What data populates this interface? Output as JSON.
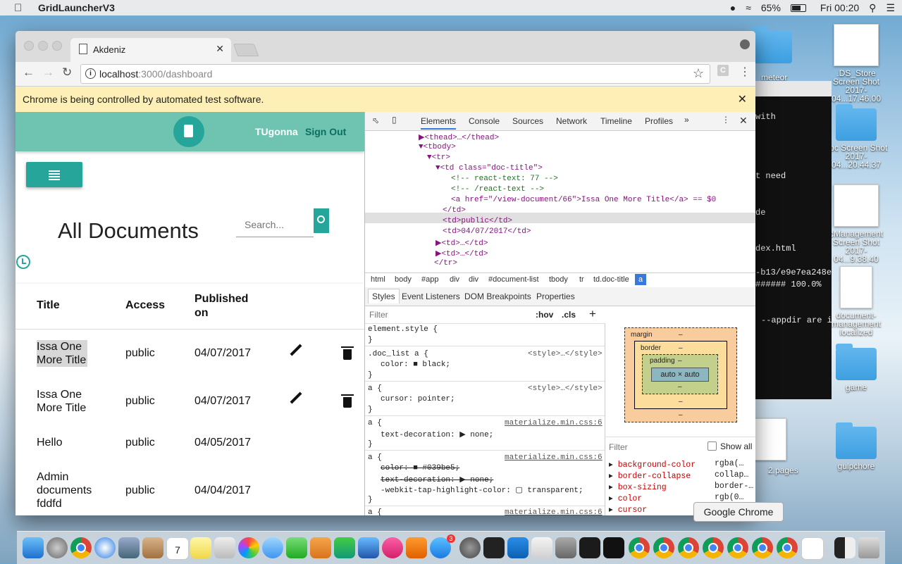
{
  "menubar": {
    "app_name": "GridLauncherV3",
    "battery": "65%",
    "clock": "Fri 00:20"
  },
  "desktop": {
    "icons": [
      {
        "label": "meteor"
      },
      {
        "label": ".DS_Store Screen Shot 2017-04...17.46.00"
      },
      {
        "label": "doc Screen Shot 2017-04...20.44.37"
      },
      {
        "label": "cManagement Screen Shot 2017-04...9.38.40"
      },
      {
        "label": "document-management"
      },
      {
        "label": "localized"
      },
      {
        "label": "game"
      },
      {
        "label": "2.pages"
      },
      {
        "label": "gulpchore"
      }
    ]
  },
  "terminal": {
    "lines": [
      "with",
      "t need",
      "de",
      "dex.html",
      "-b13/e9e7ea248e",
      "###### 100.0%",
      "--appdir are i"
    ]
  },
  "browser": {
    "tab_title": "Akdeniz",
    "url_host": "localhost",
    "url_path": ":3000/dashboard",
    "ext_label": "C",
    "infobar": "Chrome is being controlled by automated test software."
  },
  "app": {
    "user": "TUgonna",
    "signout": "Sign Out",
    "heading": "All Documents",
    "search_placeholder": "Search...",
    "columns": [
      "Title",
      "Access",
      "Published on"
    ],
    "rows": [
      {
        "title": "Issa One More Title",
        "access": "public",
        "date": "04/07/2017",
        "actions": true
      },
      {
        "title": "Issa One More Title",
        "access": "public",
        "date": "04/07/2017",
        "actions": true
      },
      {
        "title": "Hello",
        "access": "public",
        "date": "04/05/2017",
        "actions": false
      },
      {
        "title": "Admin documents fddfd",
        "access": "public",
        "date": "04/04/2017",
        "actions": false
      }
    ]
  },
  "devtools": {
    "tabs": [
      "Elements",
      "Console",
      "Sources",
      "Network",
      "Timeline",
      "Profiles"
    ],
    "dom": [
      "▶<thead>…</thead>",
      "▼<tbody>",
      "▼<tr>",
      "▼<td class=\"doc-title\">",
      "<!-- react-text: 77 -->",
      "<!-- /react-text -->",
      "<a href=\"/view-document/66\">Issa One More Title</a> == $0",
      "</td>",
      "<td>public</td>",
      "<td>04/07/2017</td>",
      "▶<td>…</td>",
      "▶<td>…</td>",
      "</tr>"
    ],
    "breadcrumbs": [
      "html",
      "body",
      "#app",
      "div",
      "div",
      "#document-list",
      "tbody",
      "tr",
      "td.doc-title",
      "a"
    ],
    "subtabs": [
      "Styles",
      "Event Listeners",
      "DOM Breakpoints",
      "Properties"
    ],
    "filter_placeholder": "Filter",
    "hov": ":hov",
    "cls": ".cls",
    "styles": [
      {
        "sel": "element.style {",
        "src": ""
      },
      {
        "sel": ".doc_list a {",
        "src": "<style>…</style>",
        "props": [
          "color: ■ black;"
        ]
      },
      {
        "sel": "a {",
        "src": "<style>…</style>",
        "props": [
          "cursor: pointer;"
        ]
      },
      {
        "sel": "a {",
        "src": "materialize.min.css:6",
        "props": [
          "text-decoration: ▶ none;"
        ]
      },
      {
        "sel": "a {",
        "src": "materialize.min.css:6",
        "props": [
          "color: ■ #039be5;",
          "text-decoration: ▶ none;",
          "-webkit-tap-highlight-color: ▢ transparent;"
        ]
      },
      {
        "sel": "a {",
        "src": "materialize.min.css:6"
      }
    ],
    "boxmodel": {
      "margin": "margin",
      "border": "border",
      "padding": "padding",
      "content": "auto × auto",
      "dash": "–"
    },
    "computed_filter": "Filter",
    "show_all": "Show all",
    "computed": [
      {
        "prop": "background-color",
        "val": "rgba(…"
      },
      {
        "prop": "border-collapse",
        "val": "collap…"
      },
      {
        "prop": "box-sizing",
        "val": "border-…"
      },
      {
        "prop": "color",
        "val": "rgb(0…"
      },
      {
        "prop": "cursor",
        "val": ""
      }
    ]
  },
  "tooltip": "Google Chrome",
  "dock_badges": {
    "calendar_day": "7",
    "calendar_month": "APR",
    "appstore_badge": "3"
  }
}
